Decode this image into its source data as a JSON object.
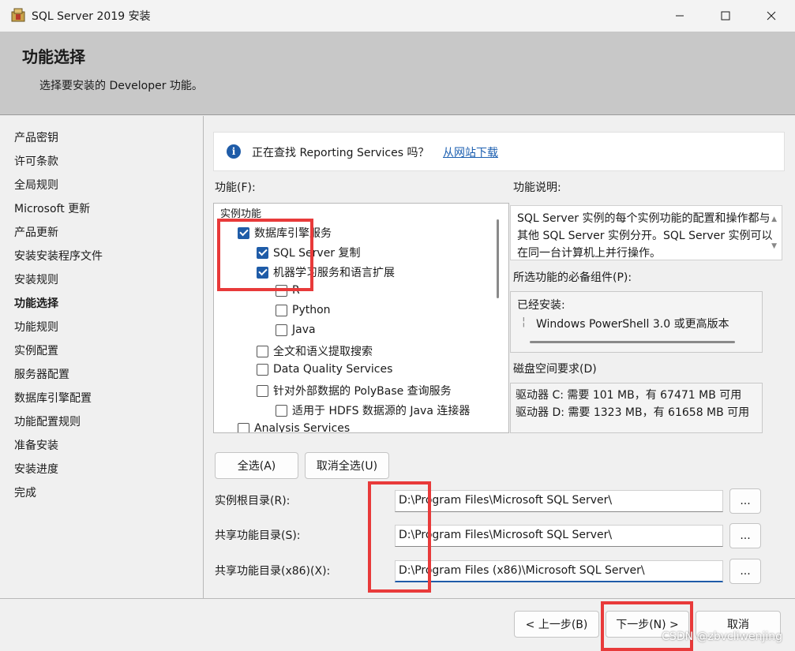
{
  "window": {
    "title": "SQL Server 2019 安装",
    "minimize_glyph": "—",
    "maximize_glyph": "☐",
    "close_glyph": "✕"
  },
  "header": {
    "title": "功能选择",
    "subtitle": "选择要安装的 Developer 功能。"
  },
  "sidebar": {
    "items": [
      {
        "label": "产品密钥"
      },
      {
        "label": "许可条款"
      },
      {
        "label": "全局规则"
      },
      {
        "label": "Microsoft 更新"
      },
      {
        "label": "产品更新"
      },
      {
        "label": "安装安装程序文件"
      },
      {
        "label": "安装规则"
      },
      {
        "label": "功能选择",
        "active": true
      },
      {
        "label": "功能规则"
      },
      {
        "label": "实例配置"
      },
      {
        "label": "服务器配置"
      },
      {
        "label": "数据库引擎配置"
      },
      {
        "label": "功能配置规则"
      },
      {
        "label": "准备安装"
      },
      {
        "label": "安装进度"
      },
      {
        "label": "完成"
      }
    ]
  },
  "info_bar": {
    "icon": "info-icon",
    "text": "正在查找 Reporting Services 吗？",
    "link": "从网站下载"
  },
  "features": {
    "label": "功能(F):",
    "items": [
      {
        "label": "实例功能",
        "checkbox": false,
        "checked": false
      },
      {
        "label": "数据库引擎服务",
        "checkbox": true,
        "checked": true
      },
      {
        "label": "SQL Server 复制",
        "checkbox": true,
        "checked": true
      },
      {
        "label": "机器学习服务和语言扩展",
        "checkbox": true,
        "checked": true
      },
      {
        "label": "R",
        "checkbox": true,
        "checked": false
      },
      {
        "label": "Python",
        "checkbox": true,
        "checked": false
      },
      {
        "label": "Java",
        "checkbox": true,
        "checked": false
      },
      {
        "label": "全文和语义提取搜索",
        "checkbox": true,
        "checked": false
      },
      {
        "label": "Data Quality Services",
        "checkbox": true,
        "checked": false
      },
      {
        "label": "针对外部数据的 PolyBase 查询服务",
        "checkbox": true,
        "checked": false
      },
      {
        "label": "适用于 HDFS 数据源的 Java 连接器",
        "checkbox": true,
        "checked": false
      },
      {
        "label": "Analysis Services",
        "checkbox": true,
        "checked": false
      }
    ]
  },
  "description": {
    "label": "功能说明:",
    "text": "SQL Server 实例的每个实例功能的配置和操作都与其他 SQL Server 实例分开。SQL Server 实例可以在同一台计算机上并行操作。"
  },
  "prerequisites": {
    "label": "所选功能的必备组件(P):",
    "group": "已经安装:",
    "items": [
      "Windows PowerShell 3.0 或更高版本"
    ]
  },
  "disk": {
    "label": "磁盘空间要求(D)",
    "lines": [
      "驱动器 C: 需要 101 MB，有 67471 MB 可用",
      "驱动器 D: 需要 1323 MB，有 61658 MB 可用"
    ]
  },
  "selection_buttons": {
    "select_all": "全选(A)",
    "deselect_all": "取消全选(U)"
  },
  "paths": {
    "instance_root": {
      "label": "实例根目录(R):",
      "value": "D:\\Program Files\\Microsoft SQL Server\\"
    },
    "shared": {
      "label": "共享功能目录(S):",
      "value": "D:\\Program Files\\Microsoft SQL Server\\"
    },
    "shared_x86": {
      "label": "共享功能目录(x86)(X):",
      "value": "D:\\Program Files (x86)\\Microsoft SQL Server\\"
    },
    "browse_label": "..."
  },
  "footer": {
    "back": "< 上一步(B)",
    "next": "下一步(N) >",
    "cancel": "取消"
  },
  "watermark": "CSDN @zbvcliwenjing",
  "colors": {
    "accent": "#1f5ca8",
    "annotation_red": "#e83a3a",
    "header_bg": "#c8c8c8"
  }
}
